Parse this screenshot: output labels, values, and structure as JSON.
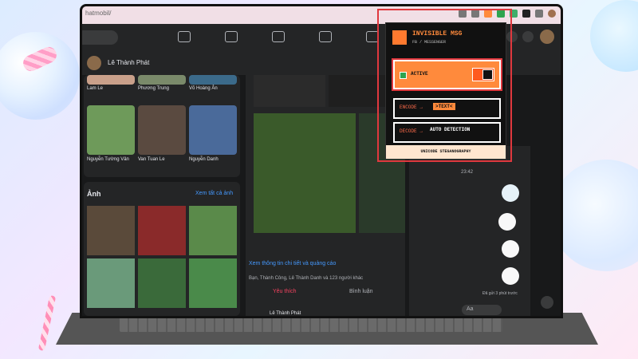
{
  "browser": {
    "url_fragment": "hatmobil/"
  },
  "profile": {
    "name": "Lê Thành Phát"
  },
  "friends": {
    "row1": [
      "Lam Le",
      "Phương Trung",
      "Võ Hoàng Ân"
    ],
    "row2": [
      "Nguyễn Tường Vân",
      "Van Tuan Le",
      "Nguyễn Danh"
    ]
  },
  "photos_section": {
    "title": "Ảnh",
    "see_all": "Xem tất cả ảnh"
  },
  "post": {
    "insights_link": "Xem thông tin chi tiết và quảng cáo",
    "reactions": "Bạn, Thành Công, Lê Thành Danh và 123 người khác",
    "like_label": "Yêu thích",
    "comment_label": "Bình luận",
    "comment_author": "Lê Thành Phát"
  },
  "chat": {
    "time": "23:42",
    "seen": "Đã gửi 3 phút trước",
    "input_placeholder": "Aa"
  },
  "extension": {
    "title": "INVISIBLE MSG",
    "subtitle": "FB / MESSENGER",
    "active_label": "ACTIVE",
    "encode_label": "ENCODE →",
    "encode_value": ">TEXT<",
    "decode_label": "DECODE →",
    "decode_value": "AUTO DETECTION",
    "footer": "UNICODE STEGANOGRAPHY",
    "accent_color": "#ff8a3c",
    "highlight_color": "#e0383e"
  },
  "colors": {
    "fb_dark_bg": "#18191a",
    "fb_card_bg": "#242526",
    "link_blue": "#4599ff"
  }
}
